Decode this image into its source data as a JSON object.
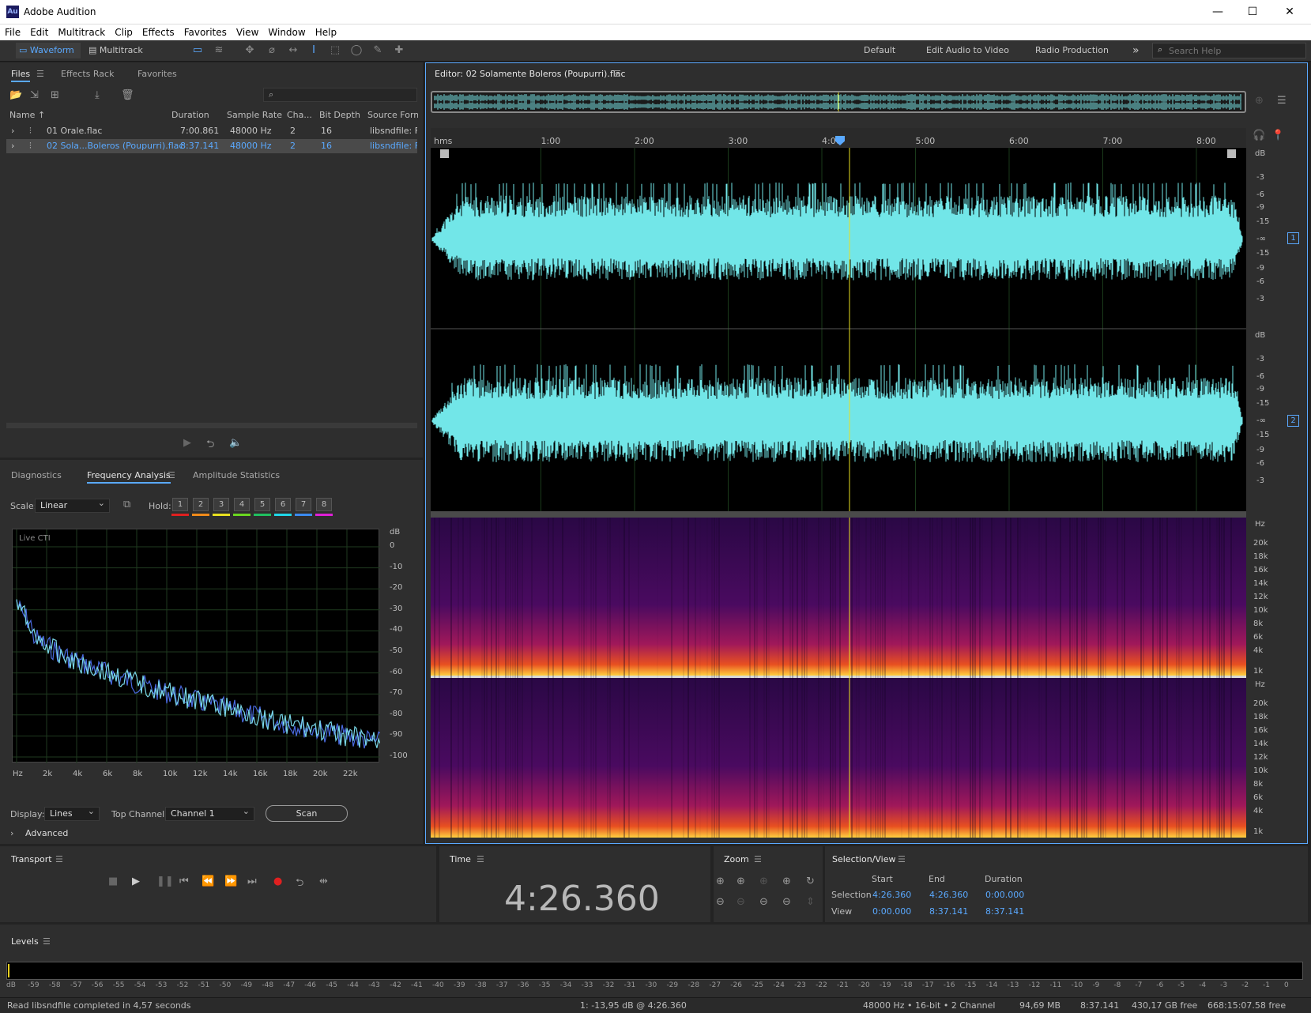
{
  "app": {
    "title": "Adobe Audition",
    "logo": "Au"
  },
  "menu": [
    "File",
    "Edit",
    "Multitrack",
    "Clip",
    "Effects",
    "Favorites",
    "View",
    "Window",
    "Help"
  ],
  "toolbar": {
    "waveform": "Waveform",
    "multitrack": "Multitrack",
    "workspaces": [
      "Default",
      "Edit Audio to Video",
      "Radio Production"
    ],
    "more": "»",
    "search_placeholder": "Search Help"
  },
  "files_panel": {
    "tabs": [
      "Files",
      "Effects Rack",
      "Favorites"
    ],
    "columns": [
      "Name ↑",
      "Duration",
      "Sample Rate",
      "Cha...",
      "Bit Depth",
      "Source Form"
    ],
    "rows": [
      {
        "name": "01 Orale.flac",
        "duration": "7:00.861",
        "rate": "48000 Hz",
        "ch": "2",
        "bits": "16",
        "src": "libsndfile: FL"
      },
      {
        "name": "02 Sola...Boleros (Poupurri).flac",
        "duration": "8:37.141",
        "rate": "48000 Hz",
        "ch": "2",
        "bits": "16",
        "src": "libsndfile: FL"
      }
    ]
  },
  "analysis": {
    "tabs": [
      "Diagnostics",
      "Frequency Analysis",
      "Amplitude Statistics"
    ],
    "scale_label": "Scale:",
    "scale_value": "Linear",
    "hold_label": "Hold:",
    "hold": [
      "1",
      "2",
      "3",
      "4",
      "5",
      "6",
      "7",
      "8"
    ],
    "hold_colors": [
      "#e02020",
      "#f08a1a",
      "#e8e020",
      "#6ad820",
      "#20c060",
      "#20d8e8",
      "#3a8af0",
      "#e020d8"
    ],
    "live": "Live CTI",
    "db_unit": "dB",
    "db_ticks": [
      "0",
      "-10",
      "-20",
      "-30",
      "-40",
      "-50",
      "-60",
      "-70",
      "-80",
      "-90",
      "-100"
    ],
    "hz_ticks": [
      "Hz",
      "2k",
      "4k",
      "6k",
      "8k",
      "10k",
      "12k",
      "14k",
      "16k",
      "18k",
      "20k",
      "22k"
    ],
    "display_label": "Display:",
    "display_value": "Lines",
    "top_channel_label": "Top Channel:",
    "top_channel_value": "Channel 1",
    "scan": "Scan",
    "advanced": "Advanced"
  },
  "editor": {
    "title": "Editor: 02 Solamente Boleros (Poupurri).flac",
    "ruler": [
      "hms",
      "1:00",
      "2:00",
      "3:00",
      "4:00",
      "5:00",
      "6:00",
      "7:00",
      "8:00"
    ],
    "db_unit": "dB",
    "wave_db": [
      "-3",
      "-6",
      "-9",
      "-15",
      "-∞",
      "-15",
      "-9",
      "-6",
      "-3"
    ],
    "channels": [
      "1",
      "2"
    ],
    "hz_unit": "Hz",
    "hz_ticks": [
      "20k",
      "18k",
      "16k",
      "14k",
      "12k",
      "10k",
      "8k",
      "6k",
      "4k",
      "1k"
    ]
  },
  "transport": {
    "title": "Transport"
  },
  "time": {
    "title": "Time",
    "value": "4:26.360"
  },
  "zoom": {
    "title": "Zoom"
  },
  "selection": {
    "title": "Selection/View",
    "cols": [
      "Start",
      "End",
      "Duration"
    ],
    "rows": [
      {
        "label": "Selection",
        "start": "4:26.360",
        "end": "4:26.360",
        "dur": "0:00.000"
      },
      {
        "label": "View",
        "start": "0:00.000",
        "end": "8:37.141",
        "dur": "8:37.141"
      }
    ]
  },
  "levels": {
    "title": "Levels",
    "ticks": [
      "dB",
      "-59",
      "-58",
      "-57",
      "-56",
      "-55",
      "-54",
      "-53",
      "-52",
      "-51",
      "-50",
      "-49",
      "-48",
      "-47",
      "-46",
      "-45",
      "-44",
      "-43",
      "-42",
      "-41",
      "-40",
      "-39",
      "-38",
      "-37",
      "-36",
      "-35",
      "-34",
      "-33",
      "-32",
      "-31",
      "-30",
      "-29",
      "-28",
      "-27",
      "-26",
      "-25",
      "-24",
      "-23",
      "-22",
      "-21",
      "-20",
      "-19",
      "-18",
      "-17",
      "-16",
      "-15",
      "-14",
      "-13",
      "-12",
      "-11",
      "-10",
      "-9",
      "-8",
      "-7",
      "-6",
      "-5",
      "-4",
      "-3",
      "-2",
      "-1",
      "0"
    ]
  },
  "status": {
    "left": "Read libsndfile completed in 4,57 seconds",
    "cursor": "1: -13,95 dB @ 4:26.360",
    "format": "48000 Hz • 16-bit • 2 Channel",
    "size": "94,69 MB",
    "dur": "8:37.141",
    "free": "430,17 GB free",
    "freetime": "668:15:07.58 free"
  }
}
